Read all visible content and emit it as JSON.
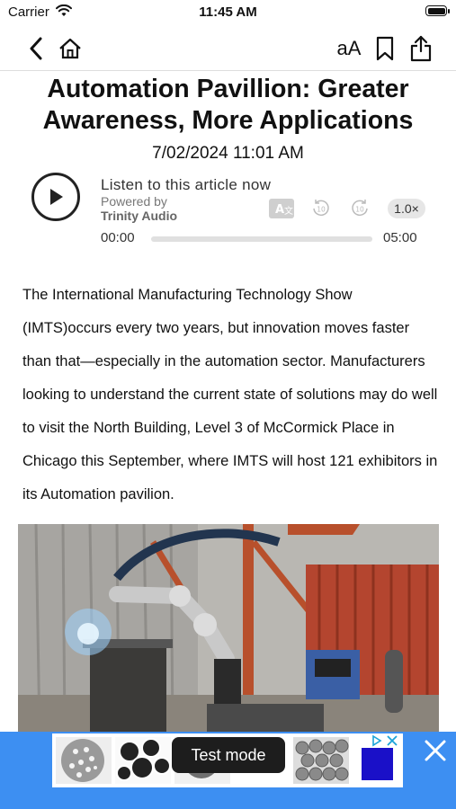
{
  "status_bar": {
    "carrier": "Carrier",
    "time": "11:45 AM"
  },
  "navbar": {
    "text_size_label": "aA"
  },
  "article": {
    "title": "Automation Pavillion: Greater Awareness, More Applications",
    "date": "7/02/2024 11:01 AM",
    "body": "The International Manufacturing Technology Show (IMTS)occurs every two years, but innovation moves faster than that—especially in the automation sector. Manufacturers looking to understand the current state of solutions may do well to visit the North Building, Level 3 of McCormick Place in Chicago this September, where IMTS will host 121 exhibitors in its Automation pavilion."
  },
  "audio_player": {
    "listen_label": "Listen to this article now",
    "powered_by": "Powered by",
    "provider": "Trinity Audio",
    "speed": "1.0×",
    "current_time": "00:00",
    "total_time": "05:00",
    "progress": 0
  },
  "ad": {
    "test_mode_label": "Test mode"
  },
  "colors": {
    "ad_background": "#3d8ff2",
    "text": "#111111"
  }
}
